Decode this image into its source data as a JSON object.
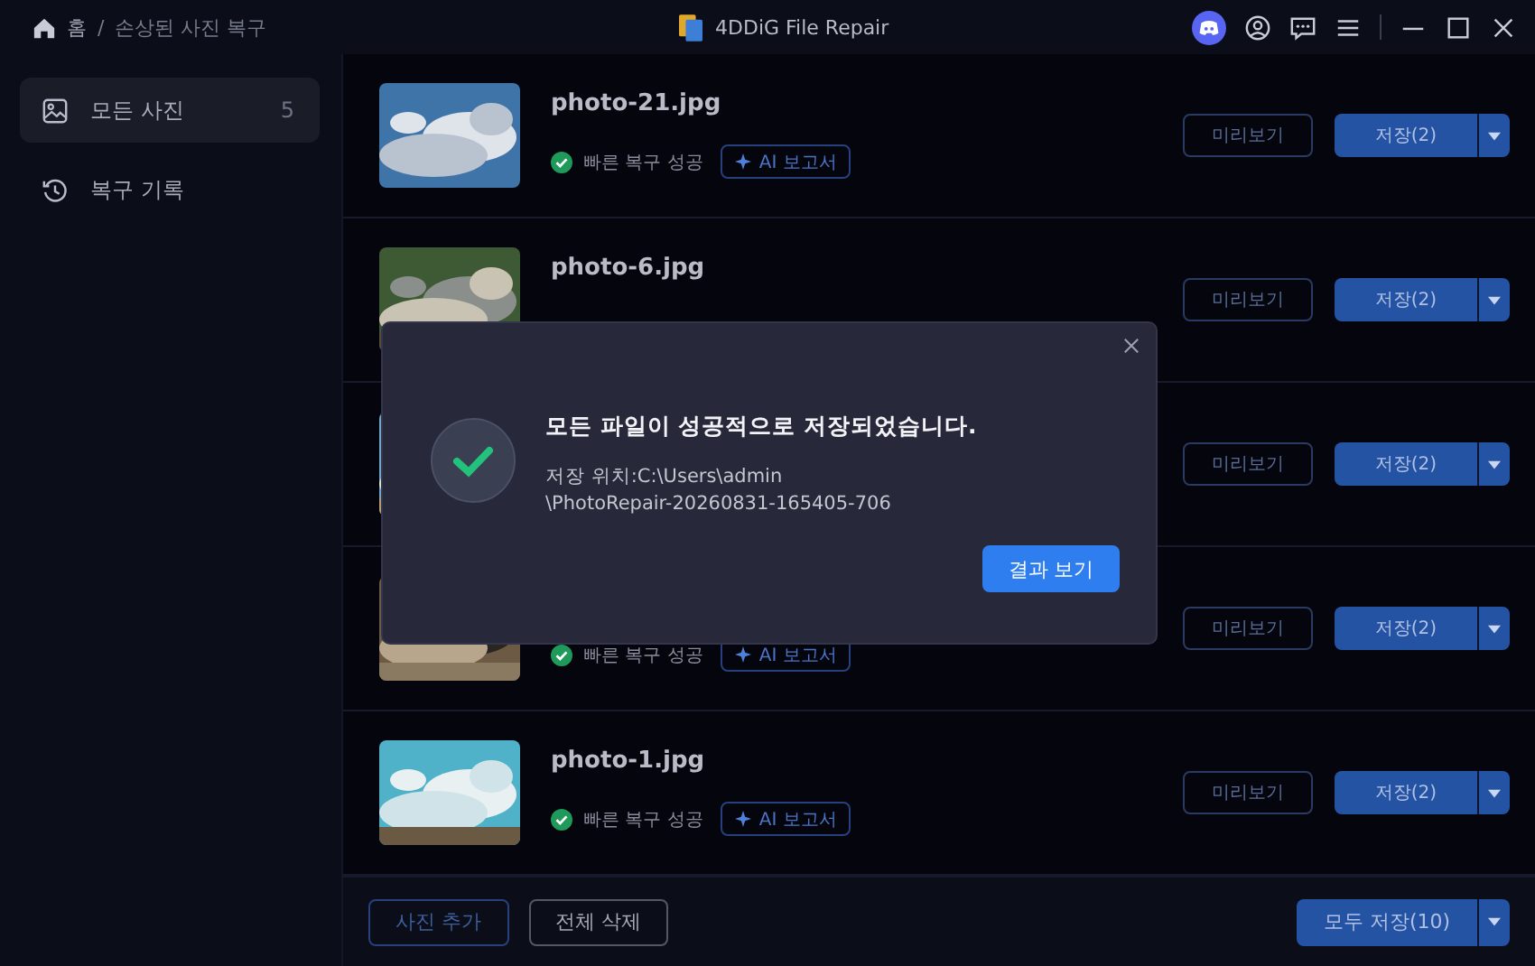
{
  "titlebar": {
    "breadcrumb": [
      "홈",
      "/",
      "손상된 사진 복구"
    ],
    "app_title": "4DDiG File Repair"
  },
  "sidebar": {
    "items": [
      {
        "label": "모든 사진",
        "count": "5",
        "selected": true
      },
      {
        "label": "복구 기록",
        "selected": false
      }
    ]
  },
  "rows": [
    {
      "name": "photo-21.jpg",
      "status": "빠른 복구 성공",
      "ai_badge": "AI 보고서",
      "preview": "미리보기",
      "save": "저장(2)"
    },
    {
      "name": "photo-6.jpg",
      "preview": "미리보기",
      "save": "저장(2)"
    },
    {
      "preview": "미리보기",
      "save": "저장(2)"
    },
    {
      "status": "빠른 복구 성공",
      "ai_badge": "AI 보고서",
      "preview": "미리보기",
      "save": "저장(2)"
    },
    {
      "name": "photo-1.jpg",
      "status": "빠른 복구 성공",
      "ai_badge": "AI 보고서",
      "preview": "미리보기",
      "save": "저장(2)"
    }
  ],
  "footer": {
    "add": "사진 추가",
    "delete_all": "전체 삭제",
    "save_all": "모두 저장(10)"
  },
  "dialog": {
    "title": "모든 파일이 성공적으로 저장되었습니다.",
    "path_line_1": "저장 위치:C:\\Users\\admin",
    "path_line_2": "\\PhotoRepair-20260831-165405-706",
    "button": "결과 보기"
  }
}
